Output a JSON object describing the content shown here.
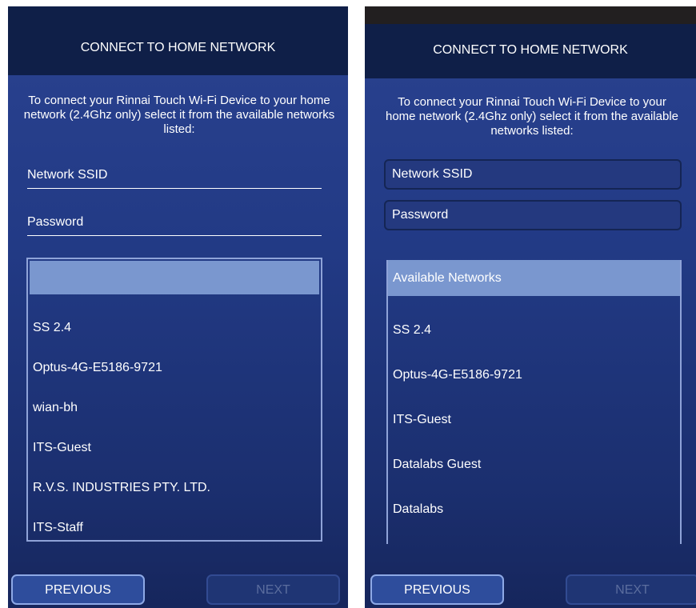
{
  "left": {
    "title": "CONNECT TO HOME NETWORK",
    "intro": "To connect your Rinnai Touch Wi-Fi Device to your home network (2.4Ghz only) select it from the available networks listed:",
    "ssid_placeholder": "Network SSID",
    "password_placeholder": "Password",
    "list_header": "",
    "networks": [
      "SS 2.4",
      "Optus-4G-E5186-9721",
      "wian-bh",
      "ITS-Guest",
      "R.V.S. INDUSTRIES PTY. LTD.",
      "ITS-Staff"
    ],
    "previous_label": "PREVIOUS",
    "next_label": "NEXT"
  },
  "right": {
    "title": "CONNECT TO HOME NETWORK",
    "intro": "To connect your Rinnai Touch Wi-Fi Device to your home network (2.4Ghz only) select it from the available networks listed:",
    "ssid_placeholder": "Network SSID",
    "password_placeholder": "Password",
    "list_header": "Available Networks",
    "networks": [
      "SS 2.4",
      "Optus-4G-E5186-9721",
      "ITS-Guest",
      "Datalabs Guest",
      "Datalabs"
    ],
    "previous_label": "PREVIOUS",
    "next_label": "NEXT"
  },
  "colors": {
    "header_bg": "#0f1f48",
    "body_gradient_top": "#2a4290",
    "body_gradient_bottom": "#16265c",
    "list_header_bg": "#7a97cf",
    "next_disabled_text": "#5b6d9e"
  }
}
